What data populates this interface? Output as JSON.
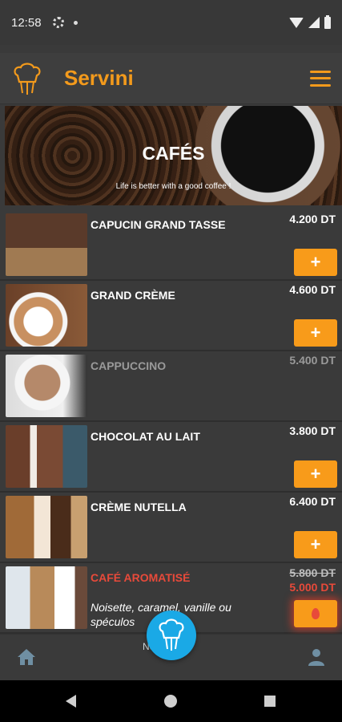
{
  "status": {
    "time": "12:58"
  },
  "app": {
    "brand": "Servini"
  },
  "banner": {
    "title": "CAFÉS",
    "subtitle": "Life is better with a good coffee !"
  },
  "items": [
    {
      "name": "CAPUCIN GRAND TASSE",
      "price": "4.200 DT",
      "add_label": "+"
    },
    {
      "name": "GRAND CRÈME",
      "price": "4.600 DT",
      "add_label": "+"
    },
    {
      "name": "CAPPUCCINO",
      "price": "5.400 DT"
    },
    {
      "name": "CHOCOLAT AU LAIT",
      "price": "3.800 DT",
      "add_label": "+"
    },
    {
      "name": "CRÈME NUTELLA",
      "price": "6.400 DT",
      "add_label": "+"
    },
    {
      "name": "CAFÉ AROMATISÉ",
      "old_price": "5.800 DT",
      "new_price": "5.000 DT",
      "description": "Noisette, caramel, vanille ou spéculos"
    }
  ],
  "bottom_nav": {
    "label": "Nos ca"
  },
  "colors": {
    "accent": "#f39a1c",
    "button": "#f89b1a",
    "promo": "#e84a3a",
    "fab": "#1aa9e6"
  },
  "icons": {
    "home": "home-icon",
    "profile": "profile-icon",
    "fab": "chef-icon",
    "menu": "hamburger-icon",
    "logo": "chef-hat-icon",
    "promo_button": "fire-icon"
  }
}
